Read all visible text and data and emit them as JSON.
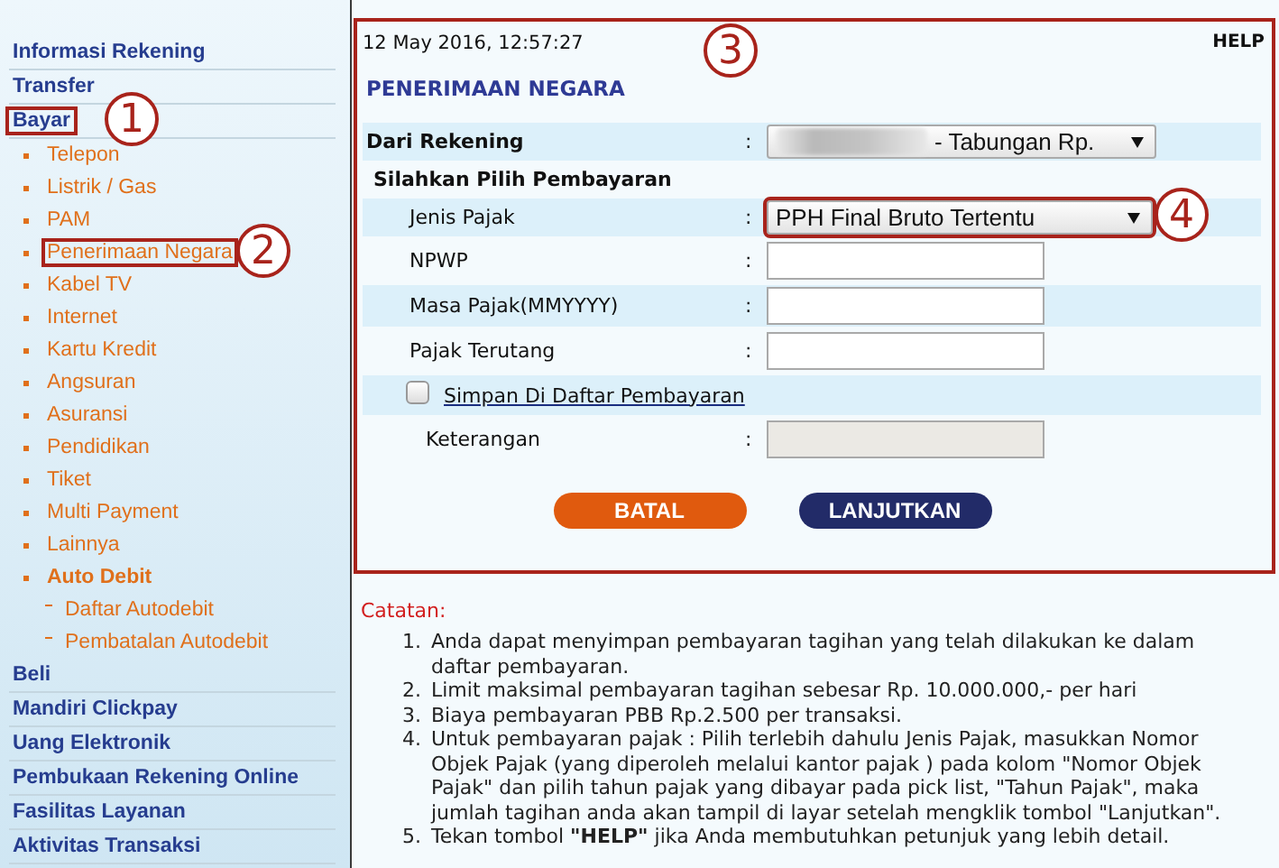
{
  "sidebar": {
    "items": [
      {
        "label": "Informasi Rekening"
      },
      {
        "label": "Transfer"
      },
      {
        "label": "Bayar",
        "callout": "1",
        "children": [
          {
            "label": "Telepon"
          },
          {
            "label": "Listrik / Gas"
          },
          {
            "label": "PAM"
          },
          {
            "label": "Penerimaan Negara",
            "callout": "2"
          },
          {
            "label": "Kabel TV"
          },
          {
            "label": "Internet"
          },
          {
            "label": "Kartu Kredit"
          },
          {
            "label": "Angsuran"
          },
          {
            "label": "Asuransi"
          },
          {
            "label": "Pendidikan"
          },
          {
            "label": "Tiket"
          },
          {
            "label": "Multi Payment"
          },
          {
            "label": "Lainnya"
          },
          {
            "label": "Auto Debit",
            "children": [
              {
                "label": "Daftar Autodebit"
              },
              {
                "label": "Pembatalan Autodebit"
              }
            ]
          }
        ]
      },
      {
        "label": "Beli"
      },
      {
        "label": "Mandiri Clickpay"
      },
      {
        "label": "Uang Elektronik"
      },
      {
        "label": "Pembukaan Rekening Online"
      },
      {
        "label": "Fasilitas Layanan"
      },
      {
        "label": "Aktivitas Transaksi"
      }
    ]
  },
  "panel": {
    "timestamp": "12 May 2016, 12:57:27",
    "help": "HELP",
    "title": "PENERIMAAN NEGARA",
    "callout": "3",
    "rows": [
      {
        "kind": "account",
        "label": "Dari Rekening",
        "colon": ":",
        "value": "- Tabungan Rp."
      },
      {
        "kind": "header",
        "label": "Silahkan Pilih Pembayaran"
      },
      {
        "kind": "select",
        "label": "Jenis Pajak",
        "colon": ":",
        "value": "PPH Final Bruto Tertentu",
        "callout": "4"
      },
      {
        "kind": "input",
        "label": "NPWP",
        "colon": ":",
        "disabled": false
      },
      {
        "kind": "input",
        "label": "Masa Pajak(MMYYYY)",
        "colon": ":",
        "disabled": false
      },
      {
        "kind": "input",
        "label": "Pajak Terutang",
        "colon": ":",
        "disabled": false
      },
      {
        "kind": "checkbox",
        "label": "Simpan Di Daftar Pembayaran",
        "checked": false
      },
      {
        "kind": "input",
        "label": "Keterangan",
        "colon": ":",
        "disabled": true
      }
    ],
    "buttons": [
      {
        "label": "BATAL",
        "kind": "cancel"
      },
      {
        "label": "LANJUTKAN",
        "kind": "continue"
      }
    ]
  },
  "notes": {
    "heading": "Catatan:",
    "items": [
      {
        "number": "1.",
        "text": "Anda dapat menyimpan pembayaran tagihan yang telah dilakukan ke dalam daftar pembayaran."
      },
      {
        "number": "2.",
        "text": "Limit maksimal pembayaran tagihan sebesar Rp. 10.000.000,- per hari"
      },
      {
        "number": "3.",
        "text": "Biaya pembayaran PBB Rp.2.500 per transaksi."
      },
      {
        "number": "4.",
        "text": "Untuk pembayaran pajak : Pilih terlebih dahulu Jenis Pajak, masukkan Nomor Objek Pajak (yang diperoleh melalui kantor pajak ) pada kolom \"Nomor Objek Pajak\" dan pilih tahun pajak yang dibayar pada pick list, \"Tahun Pajak\", maka jumlah tagihan anda akan tampil di layar setelah mengklik tombol \"Lanjutkan\"."
      },
      {
        "number": "5.",
        "text": "Tekan tombol **\"HELP\"** jika Anda membutuhkan petunjuk yang lebih detail."
      }
    ]
  }
}
